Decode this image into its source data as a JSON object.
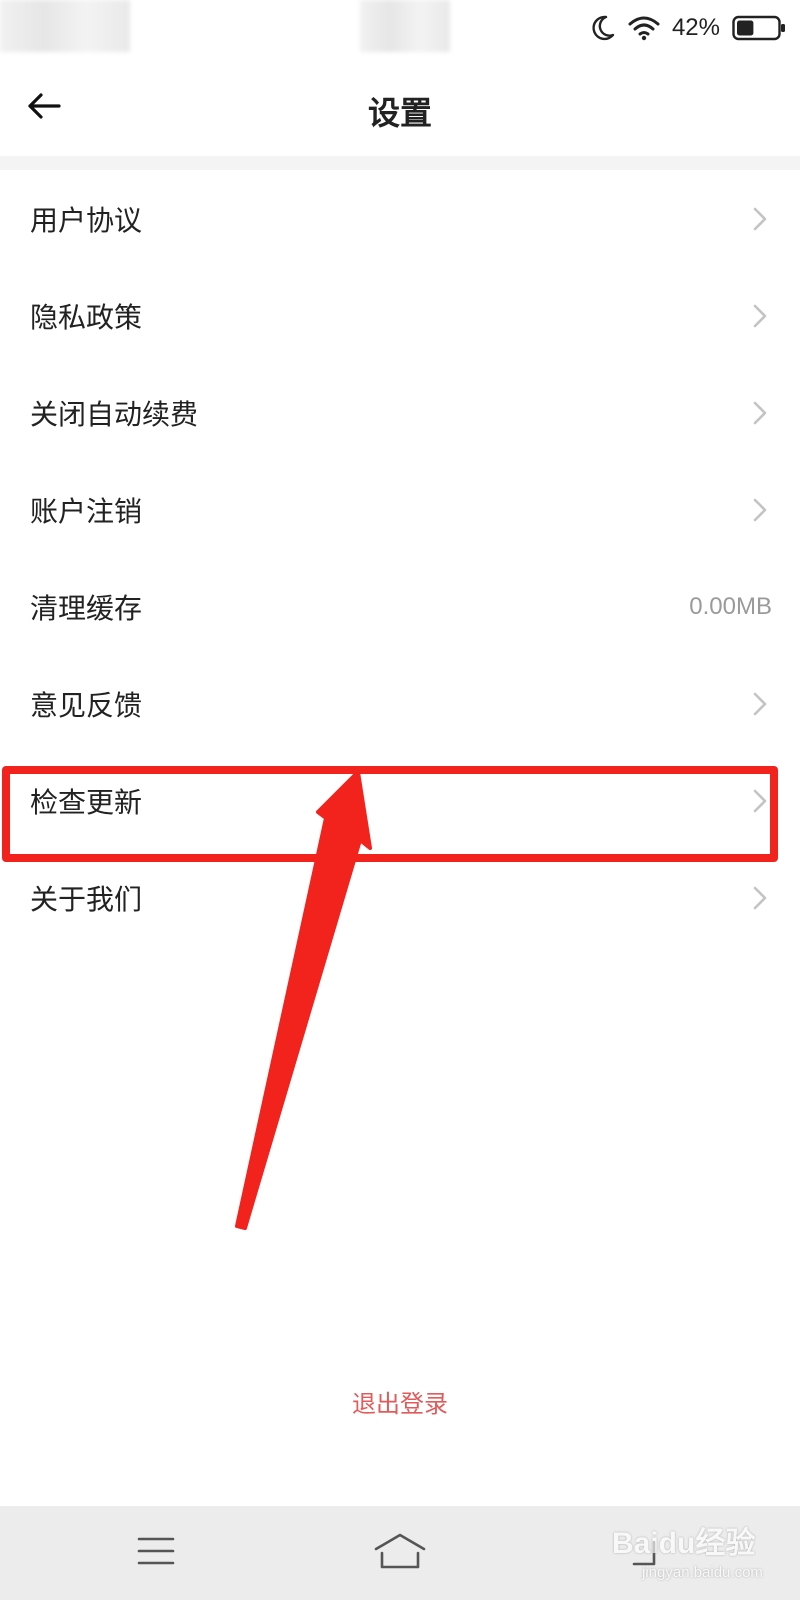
{
  "status_bar": {
    "battery_percent": "42%",
    "battery_level": 0.42,
    "icons": [
      "moon-icon",
      "wifi-icon",
      "battery-icon"
    ]
  },
  "header": {
    "title": "设置",
    "back_icon": "arrow-left-icon"
  },
  "settings": {
    "items": [
      {
        "label": "用户协议",
        "trailing": "chevron"
      },
      {
        "label": "隐私政策",
        "trailing": "chevron"
      },
      {
        "label": "关闭自动续费",
        "trailing": "chevron"
      },
      {
        "label": "账户注销",
        "trailing": "chevron"
      },
      {
        "label": "清理缓存",
        "trailing": "value",
        "value": "0.00MB"
      },
      {
        "label": "意见反馈",
        "trailing": "chevron"
      },
      {
        "label": "检查更新",
        "trailing": "chevron"
      },
      {
        "label": "关于我们",
        "trailing": "chevron"
      }
    ]
  },
  "annotation": {
    "color": "#f2231d",
    "highlighted_item": "检查更新"
  },
  "logout": {
    "label": "退出登录",
    "color": "#e25a5a"
  },
  "nav_bar": {
    "icons": [
      "menu-icon",
      "home-icon",
      "back-icon"
    ]
  },
  "watermark": {
    "main": "Baidu经验",
    "sub": "jingyan.baidu.com"
  }
}
